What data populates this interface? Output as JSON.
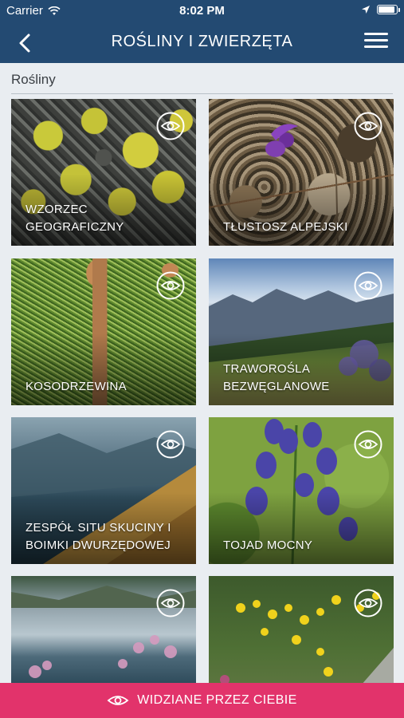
{
  "status_bar": {
    "carrier": "Carrier",
    "time": "8:02 PM"
  },
  "header": {
    "title": "ROŚLINY I ZWIERZĘTA"
  },
  "section": {
    "title": "Rośliny"
  },
  "cards": [
    {
      "label": "WZORZEC\nGEOGRAFICZNY"
    },
    {
      "label": "TŁUSTOSZ ALPEJSKI"
    },
    {
      "label": "KOSODRZEWINA"
    },
    {
      "label": "TRAWOROŚLA\nBEZWĘGLANOWE"
    },
    {
      "label": "ZESPÓŁ SITU SKUCINY I\nBOIMKI DWURZĘDOWEJ"
    },
    {
      "label": "TOJAD MOCNY"
    },
    {
      "label": ""
    },
    {
      "label": ""
    }
  ],
  "bottom_bar": {
    "label": "WIDZIANE PRZEZ CIEBIE"
  },
  "colors": {
    "header_bg": "#234a72",
    "accent": "#e2336b",
    "page_bg": "#e9edf1"
  },
  "icons": [
    "back-arrow-icon",
    "hamburger-menu-icon",
    "eye-icon",
    "wifi-icon",
    "location-arrow-icon",
    "battery-icon"
  ]
}
